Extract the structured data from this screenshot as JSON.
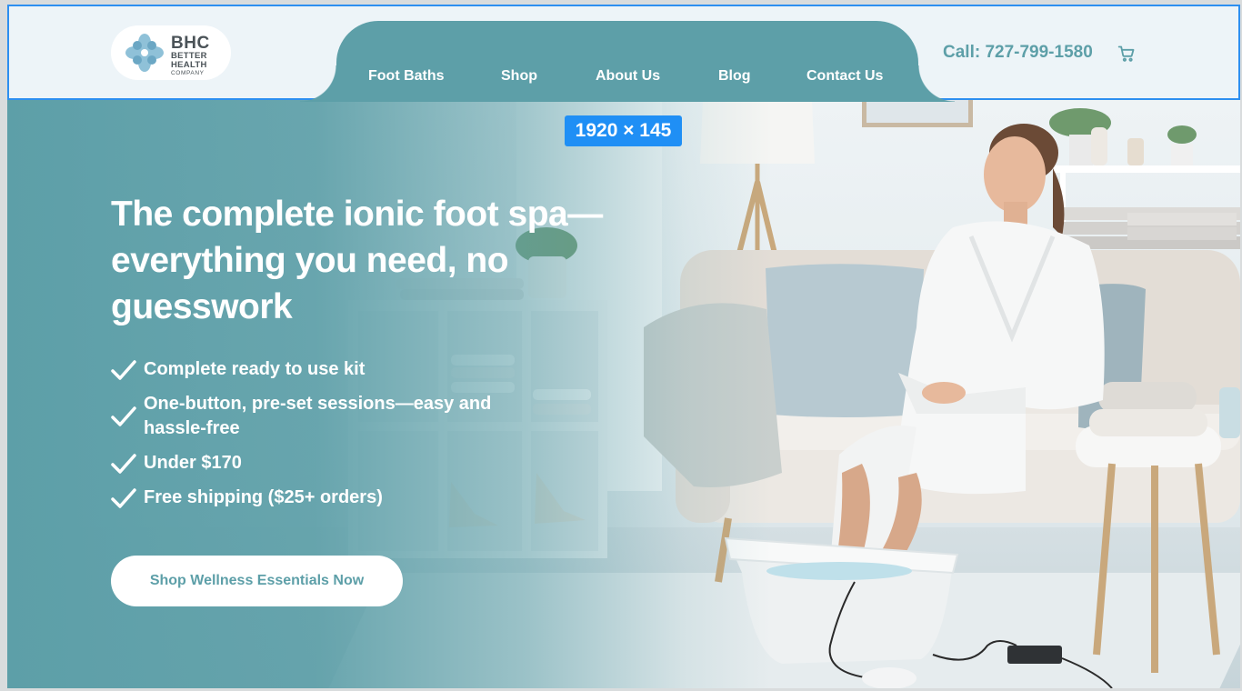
{
  "brand": {
    "logo_main": "BHC",
    "logo_line1": "BETTER",
    "logo_line2": "HEALTH",
    "logo_line3": "COMPANY"
  },
  "nav": {
    "items": [
      {
        "label": "Foot Baths"
      },
      {
        "label": "Shop"
      },
      {
        "label": "About Us"
      },
      {
        "label": "Blog"
      },
      {
        "label": "Contact Us"
      }
    ]
  },
  "header": {
    "call_label": "Call: 727-799-1580",
    "cart_icon": "cart-icon"
  },
  "overlay": {
    "dimension_badge": "1920 × 145"
  },
  "hero": {
    "headline": "The complete ionic foot spa—everything you need, no guesswork",
    "features": [
      {
        "text": "Complete ready to use kit"
      },
      {
        "text": "One-button, pre-set sessions—easy and hassle-free"
      },
      {
        "text": "Under $170"
      },
      {
        "text": "Free shipping ($25+ orders)"
      }
    ],
    "cta_label": "Shop Wellness Essentials Now"
  },
  "colors": {
    "accent": "#5d9fa8",
    "header_bg": "#edf4f8",
    "selection_outline": "#2d8ff0",
    "badge_bg": "#1f8ff5",
    "text_dark": "#4b5358"
  }
}
